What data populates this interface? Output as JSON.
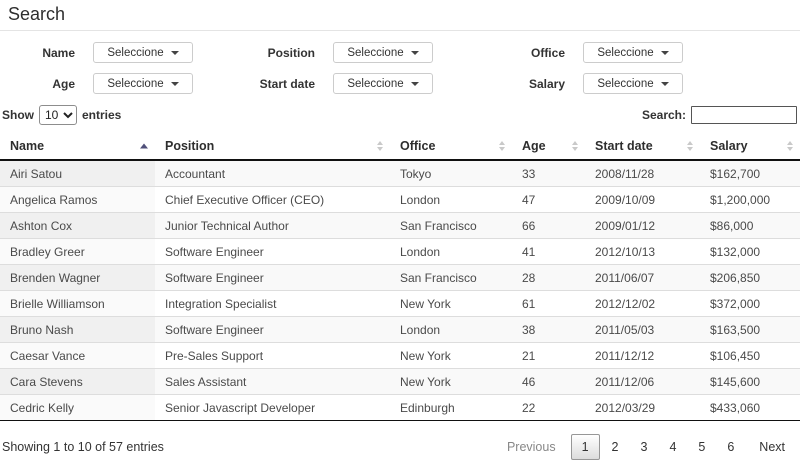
{
  "page": {
    "title": "Search"
  },
  "filters": [
    {
      "label": "Name",
      "button_label": "Seleccione"
    },
    {
      "label": "Position",
      "button_label": "Seleccione"
    },
    {
      "label": "Office",
      "button_label": "Seleccione"
    },
    {
      "label": "Age",
      "button_label": "Seleccione"
    },
    {
      "label": "Start date",
      "button_label": "Seleccione"
    },
    {
      "label": "Salary",
      "button_label": "Seleccione"
    }
  ],
  "length_control": {
    "show_label": "Show",
    "selected_value": "10",
    "entries_label": "entries"
  },
  "search_control": {
    "label": "Search:",
    "value": ""
  },
  "table": {
    "columns": [
      {
        "label": "Name",
        "sorted": "asc"
      },
      {
        "label": "Position",
        "sorted": "none"
      },
      {
        "label": "Office",
        "sorted": "none"
      },
      {
        "label": "Age",
        "sorted": "none"
      },
      {
        "label": "Start date",
        "sorted": "none"
      },
      {
        "label": "Salary",
        "sorted": "none"
      }
    ],
    "rows": [
      [
        "Airi Satou",
        "Accountant",
        "Tokyo",
        "33",
        "2008/11/28",
        "$162,700"
      ],
      [
        "Angelica Ramos",
        "Chief Executive Officer (CEO)",
        "London",
        "47",
        "2009/10/09",
        "$1,200,000"
      ],
      [
        "Ashton Cox",
        "Junior Technical Author",
        "San Francisco",
        "66",
        "2009/01/12",
        "$86,000"
      ],
      [
        "Bradley Greer",
        "Software Engineer",
        "London",
        "41",
        "2012/10/13",
        "$132,000"
      ],
      [
        "Brenden Wagner",
        "Software Engineer",
        "San Francisco",
        "28",
        "2011/06/07",
        "$206,850"
      ],
      [
        "Brielle Williamson",
        "Integration Specialist",
        "New York",
        "61",
        "2012/12/02",
        "$372,000"
      ],
      [
        "Bruno Nash",
        "Software Engineer",
        "London",
        "38",
        "2011/05/03",
        "$163,500"
      ],
      [
        "Caesar Vance",
        "Pre-Sales Support",
        "New York",
        "21",
        "2011/12/12",
        "$106,450"
      ],
      [
        "Cara Stevens",
        "Sales Assistant",
        "New York",
        "46",
        "2011/12/06",
        "$145,600"
      ],
      [
        "Cedric Kelly",
        "Senior Javascript Developer",
        "Edinburgh",
        "22",
        "2012/03/29",
        "$433,060"
      ]
    ]
  },
  "footer": {
    "info": "Showing 1 to 10 of 57 entries",
    "pagination": {
      "previous_label": "Previous",
      "pages": [
        "1",
        "2",
        "3",
        "4",
        "5",
        "6"
      ],
      "active_page": "1",
      "next_label": "Next"
    }
  },
  "icons": {
    "dropdown_caret": "caret-down",
    "sort_ascending_active": "triangle-up",
    "sort_unsorted": "triangle-up-down"
  },
  "colors": {
    "text": "#333333",
    "header_border": "#111111",
    "row_border": "#dddddd",
    "stripe_odd": "#f9f9f9",
    "stripe_odd_sorted": "#f0f0f0",
    "stripe_even": "#ffffff",
    "stripe_even_sorted": "#fafafa",
    "sort_arrow_active": "#50507a",
    "active_page_border": "#979797",
    "disabled_text": "#888888"
  }
}
